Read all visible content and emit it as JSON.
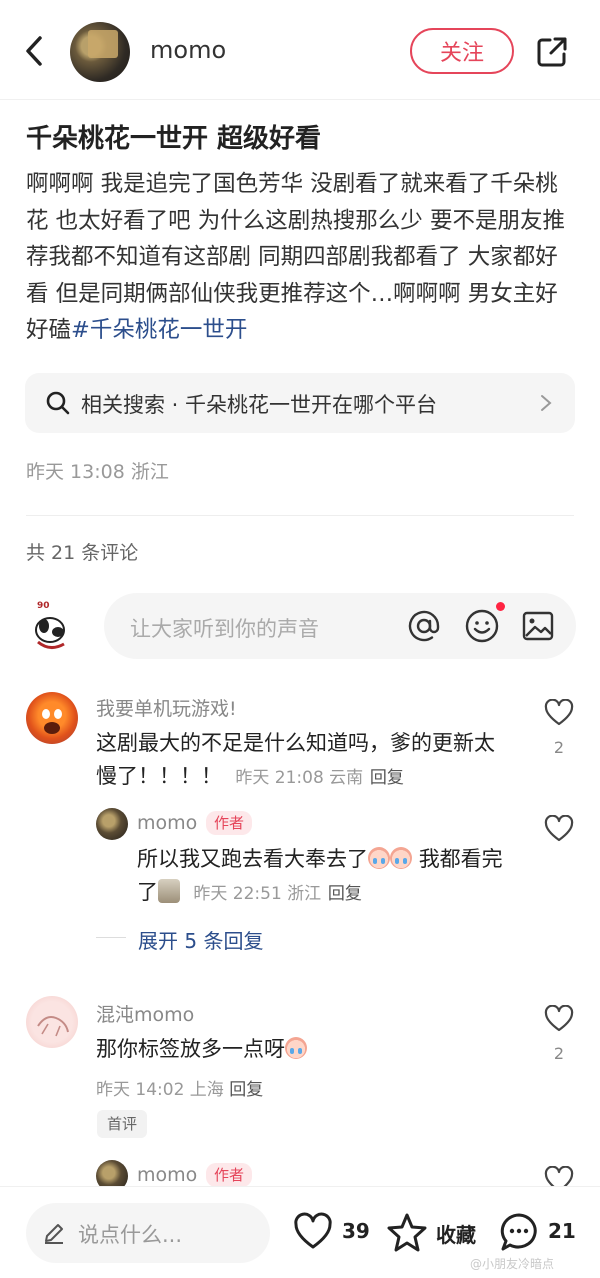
{
  "header": {
    "username": "momo",
    "follow_label": "关注"
  },
  "post": {
    "title": "千朵桃花一世开 超级好看",
    "body": "啊啊啊 我是追完了国色芳华 没剧看了就来看了千朵桃花 也太好看了吧 为什么这剧热搜那么少 要不是朋友推荐我都不知道有这部剧 同期四部剧我都看了 大家都好看 但是同期俩部仙侠我更推荐这个…啊啊啊 男女主好好磕",
    "hashtag": "#千朵桃花一世开",
    "related_search": "相关搜索 · 千朵桃花一世开在哪个平台",
    "meta": "昨天 13:08 浙江"
  },
  "comments_header": {
    "count_label": "共 21 条评论"
  },
  "composer": {
    "avatar_caption": "90",
    "placeholder": "让大家听到你的声音"
  },
  "comments": [
    {
      "name": "我要单机玩游戏!",
      "text": "这剧最大的不足是什么知道吗，爹的更新太慢了！！！！",
      "time": "昨天 21:08 云南",
      "reply": "回复",
      "likes": "2"
    },
    {
      "name": "混沌momo",
      "text": "那你标签放多一点呀",
      "time": "昨天 14:02 上海",
      "reply": "回复",
      "likes": "2",
      "badge": "首评"
    }
  ],
  "replies": [
    {
      "name": "momo",
      "tag": "作者",
      "text_a": "所以我又跑去看大奉去了",
      "text_b": "我都看完了",
      "time": "昨天 22:51 浙江",
      "reply": "回复"
    },
    {
      "name": "momo",
      "tag": "作者"
    }
  ],
  "expand_label": "展开 5 条回复",
  "bottom_bar": {
    "say_placeholder": "说点什么...",
    "likes": "39",
    "collect_label": "收藏",
    "comments": "21"
  },
  "watermark": "@小朋友冷暗点",
  "colors": {
    "accent": "#e5455a",
    "link": "#2c4e8c"
  }
}
